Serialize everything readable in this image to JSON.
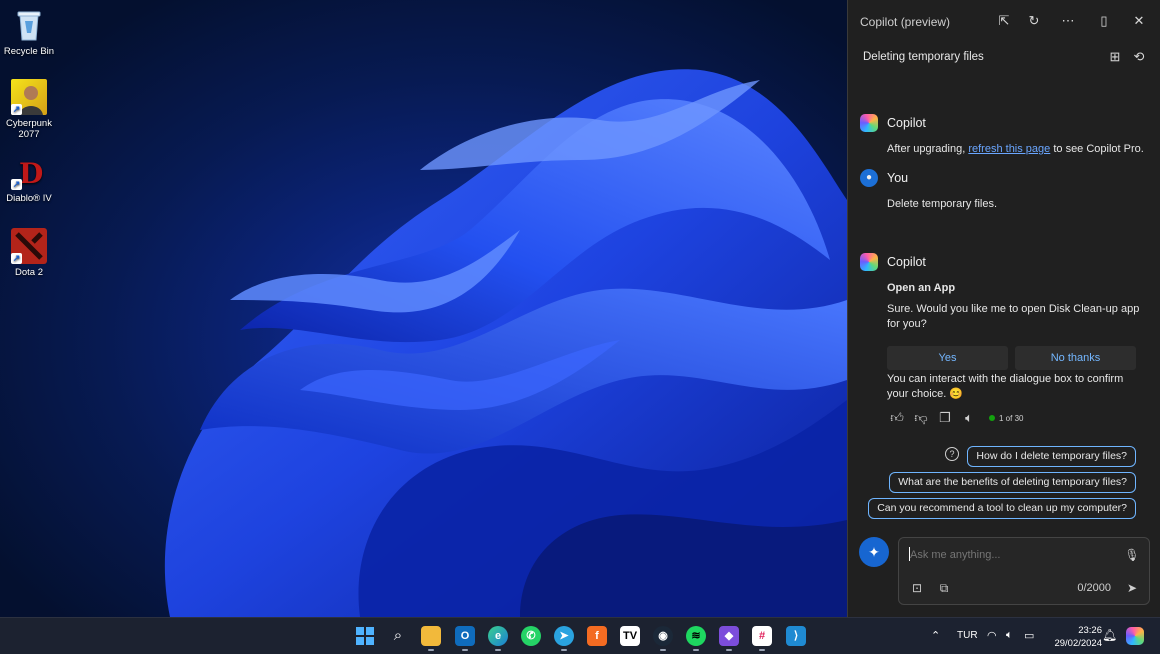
{
  "desktop": {
    "icons": [
      {
        "label": "Recycle Bin",
        "icon": "recycle-bin-icon"
      },
      {
        "label": "Cyberpunk 2077",
        "icon": "cyberpunk-icon"
      },
      {
        "label": "Diablo® IV",
        "icon": "diablo-icon"
      },
      {
        "label": "Dota 2",
        "icon": "dota-icon"
      }
    ]
  },
  "copilot": {
    "window_title": "Copilot (preview)",
    "conversation_title": "Deleting temporary files",
    "messages": [
      {
        "speaker": "Copilot",
        "text_before": "After upgrading, ",
        "link": "refresh this page",
        "text_after": " to see Copilot Pro."
      },
      {
        "speaker": "You",
        "text": "Delete temporary files."
      },
      {
        "speaker": "Copilot",
        "heading": "Open an App",
        "line1": "Sure. Would you like me to open Disk Clean-up app",
        "line2": "for you?",
        "yes": "Yes",
        "no": "No thanks",
        "follow1": "You can interact with the dialogue box to confirm",
        "follow2": "your choice. 😊",
        "turns": "1 of 30"
      }
    ],
    "suggestions": [
      "How do I delete temporary files?",
      "What are the benefits of deleting temporary files?",
      "Can you recommend a tool to clean up my computer?"
    ],
    "input": {
      "placeholder": "Ask me anything...",
      "char_count": "0/2000"
    },
    "accent": "#1766d1"
  },
  "taskbar": {
    "apps": [
      "start",
      "search",
      "file-explorer",
      "outlook",
      "edge",
      "whatsapp",
      "telegram",
      "office",
      "tradingview",
      "steam",
      "spotify",
      "obsidian",
      "slack",
      "vscode"
    ],
    "language": "TUR",
    "time": "23:26",
    "date": "29/02/2024"
  }
}
